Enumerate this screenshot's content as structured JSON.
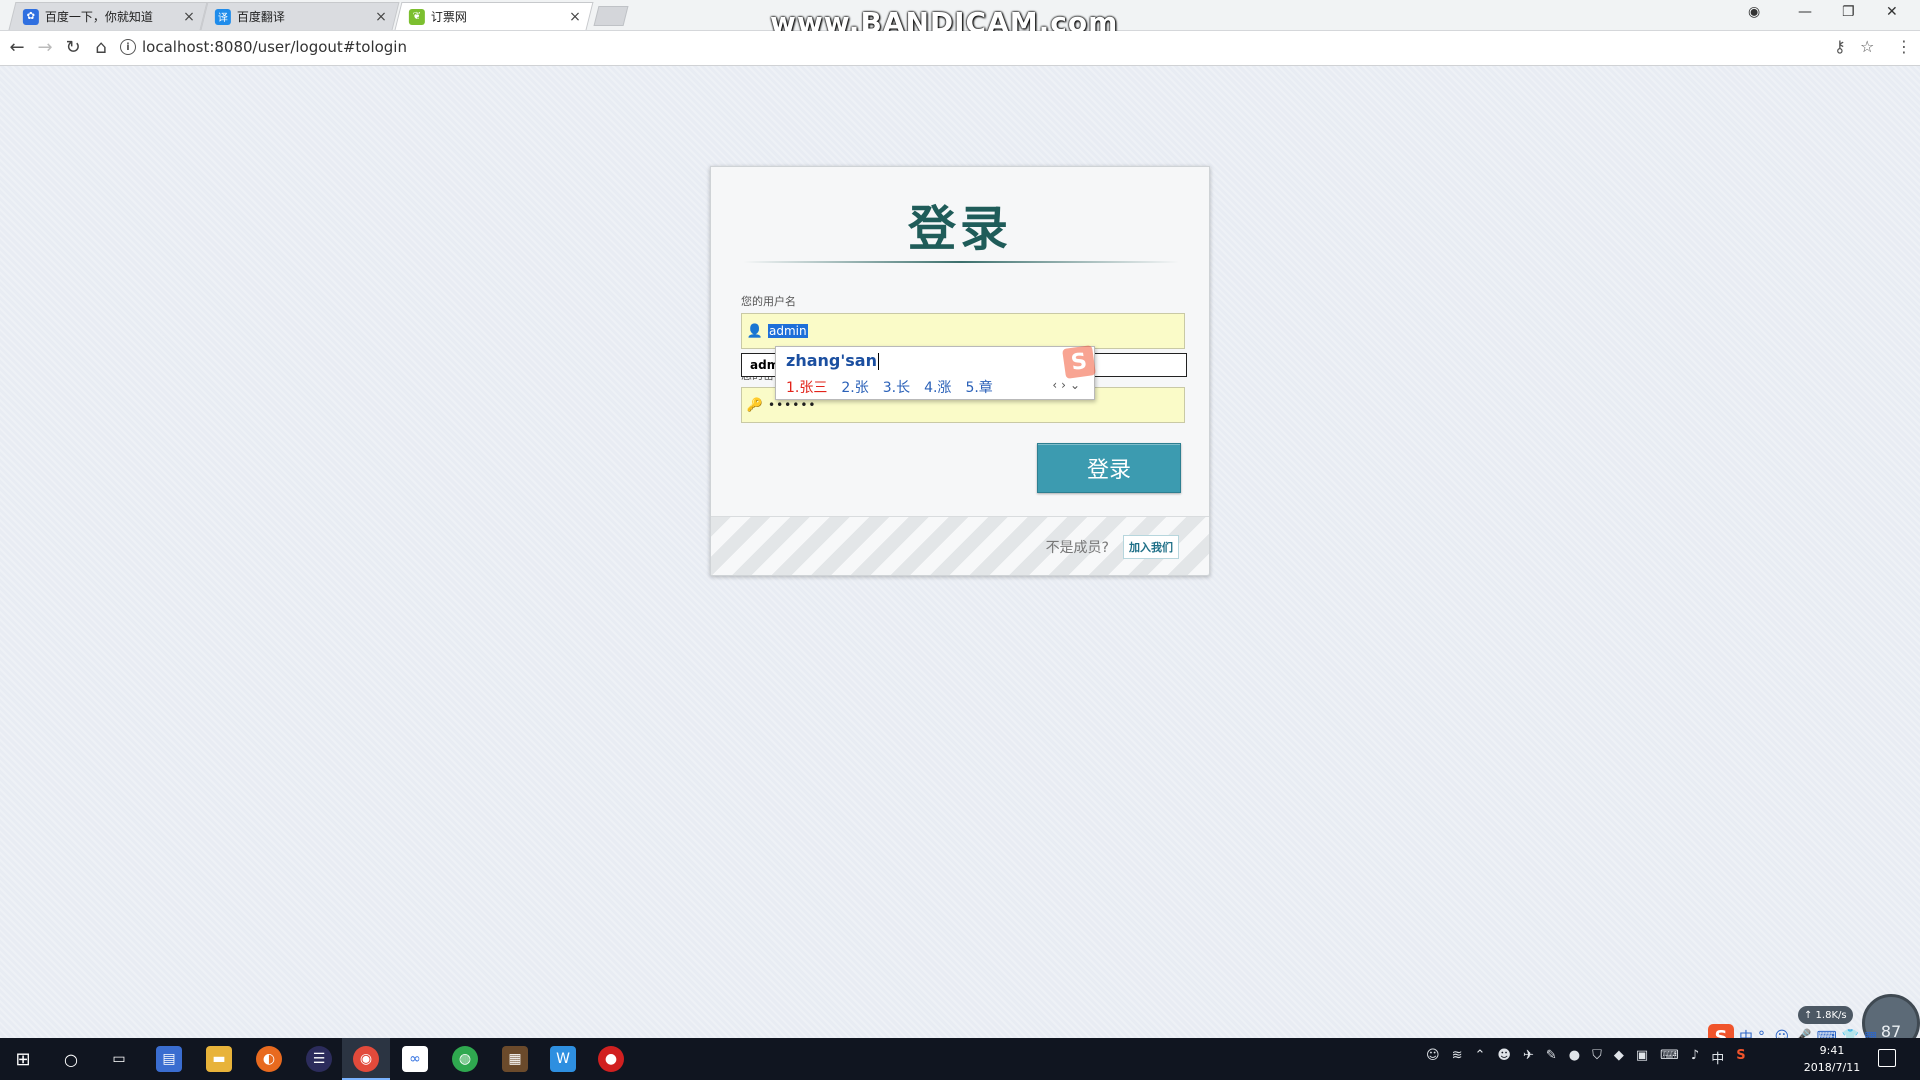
{
  "browser": {
    "tabs": [
      {
        "title": "百度一下，你就知道",
        "icon": "baidu-paw-icon",
        "color": "#2f6fe0"
      },
      {
        "title": "百度翻译",
        "icon": "baidu-translate-icon",
        "color": "#1f8ceb"
      },
      {
        "title": "订票网",
        "icon": "leaf-icon",
        "color": "#7cbf2f"
      }
    ],
    "url": "localhost:8080/user/logout#tologin",
    "watermark": "www.BANDICAM.com"
  },
  "login": {
    "title": "登录",
    "username_label": "您的用户名",
    "username_value": "admin",
    "ghost_input_value": "adm",
    "password_label": "您的密码",
    "password_value": "••••••",
    "submit_label": "登录",
    "footer_prompt": "不是成员?",
    "join_label": "加入我们"
  },
  "ime": {
    "composition": "zhang'san",
    "candidates": [
      "1.张三",
      "2.张",
      "3.长",
      "4.涨",
      "5.章"
    ],
    "logo": "S",
    "toolbar": [
      "中",
      "°,",
      "☺",
      "🎤",
      "⌨",
      "👕",
      "▦"
    ]
  },
  "network": {
    "speed": "↑ 1.8K/s",
    "gauge": "87"
  },
  "taskbar": {
    "time": "9:41",
    "date": "2018/7/11",
    "tray_lang": "中"
  },
  "colors": {
    "accent": "#3c9bb0",
    "title": "#1f5c59",
    "field_bg": "#fafbc8"
  }
}
